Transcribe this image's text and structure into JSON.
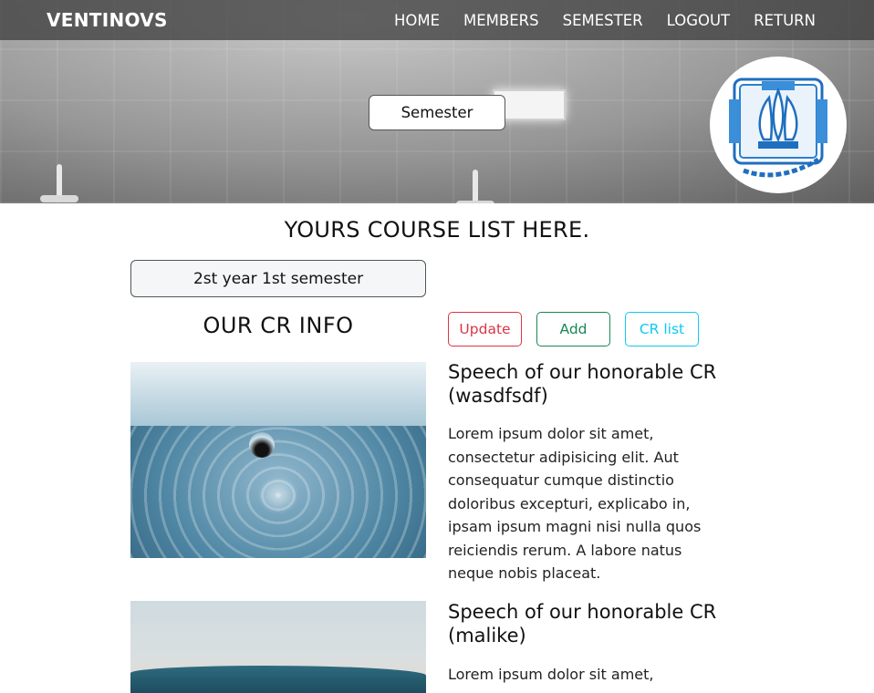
{
  "navbar": {
    "brand": "VENTINOVS",
    "links": [
      "HOME",
      "MEMBERS",
      "SEMESTER",
      "LOGOUT",
      "RETURN"
    ]
  },
  "hero": {
    "semester_button": "Semester",
    "logo_icon": "university-logo-icon"
  },
  "main": {
    "heading": "YOURS COURSE LIST HERE.",
    "year_select": "2st year 1st semester",
    "cr_heading": "OUR CR INFO",
    "buttons": {
      "update": "Update",
      "add": "Add",
      "cr_list": "CR list"
    },
    "cards": [
      {
        "title": "Speech of our honorable CR (wasdfsdf)",
        "text": "Lorem ipsum dolor sit amet, consectetur adipisicing elit. Aut consequatur cumque distinctio doloribus excepturi, explicabo in, ipsam ipsum magni nisi nulla quos reiciendis rerum. A labore natus neque nobis placeat."
      },
      {
        "title": "Speech of our honorable CR (malike)",
        "text": "Lorem ipsum dolor sit amet,"
      }
    ]
  },
  "colors": {
    "update": "#dc3545",
    "add": "#198754",
    "cr_list": "#0dcaf0",
    "navbar_bg": "#373737"
  }
}
